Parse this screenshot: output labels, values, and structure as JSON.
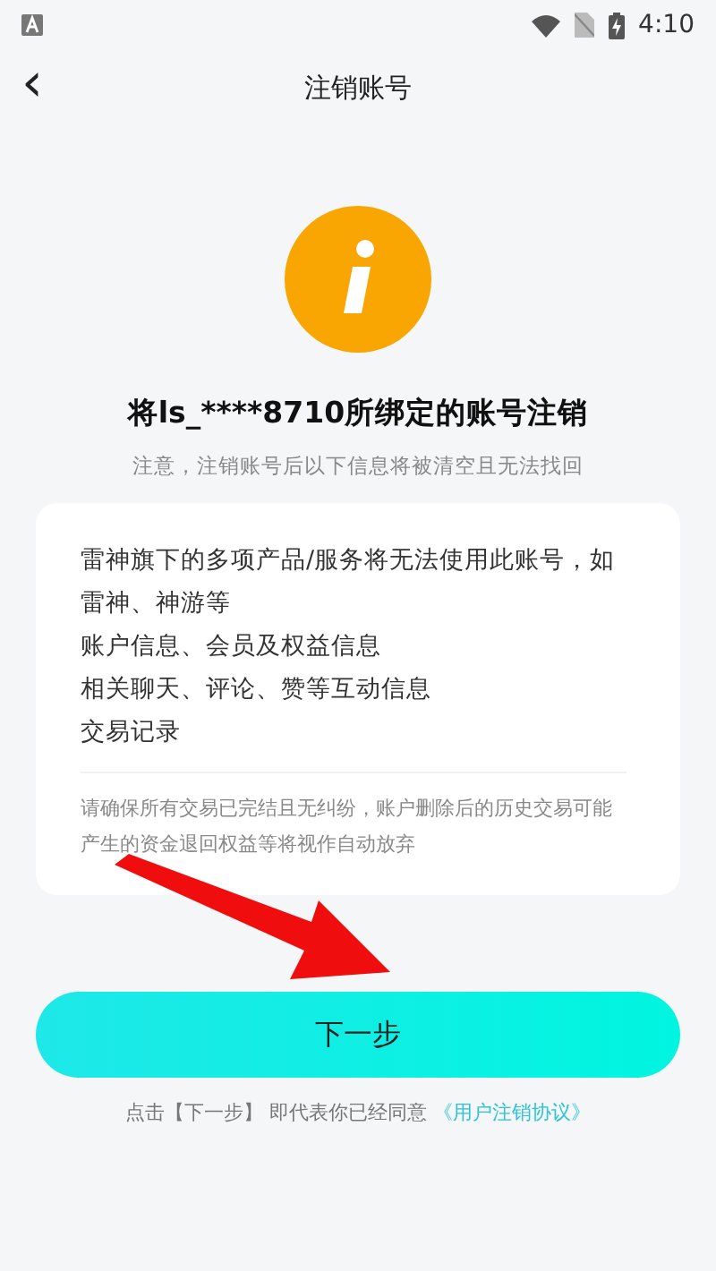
{
  "status_bar": {
    "time": "4:10"
  },
  "header": {
    "back": "‹",
    "title": "注销账号"
  },
  "heading": "将ls_****8710所绑定的账号注销",
  "subtitle": "注意，注销账号后以下信息将被清空且无法找回",
  "card": {
    "items": [
      "雷神旗下的多项产品/服务将无法使用此账号，如雷神、神游等",
      "账户信息、会员及权益信息",
      "相关聊天、评论、赞等互动信息",
      "交易记录"
    ],
    "note": "请确保所有交易已完结且无纠纷，账户删除后的历史交易可能产生的资金退回权益等将视作自动放弃"
  },
  "next_button": "下一步",
  "agreement": {
    "text": "点击【下一步】 即代表你已经同意",
    "link": "《用户注销协议》"
  }
}
